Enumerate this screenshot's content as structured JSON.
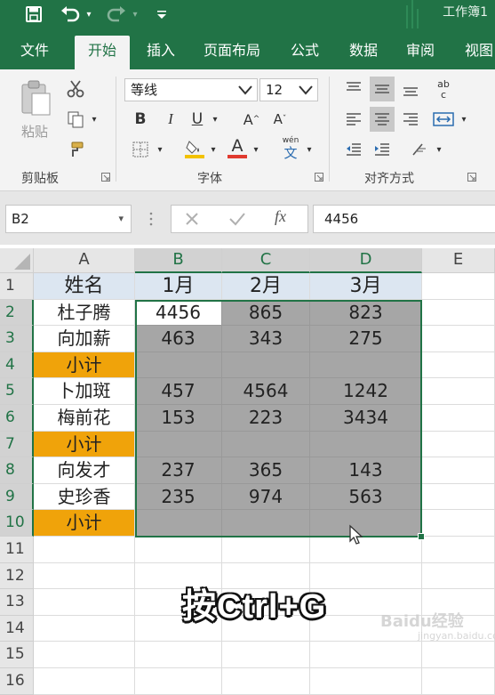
{
  "title_bar": {
    "window_title": "工作簿1",
    "icons": [
      "save-icon",
      "undo-icon",
      "redo-icon",
      "customize-qat-icon"
    ]
  },
  "tabs": [
    "文件",
    "开始",
    "插入",
    "页面布局",
    "公式",
    "数据",
    "审阅",
    "视图"
  ],
  "active_tab": "开始",
  "ribbon": {
    "clipboard": {
      "paste_label": "粘贴",
      "group_label": "剪贴板"
    },
    "font": {
      "font_name": "等线",
      "font_size": "12",
      "bold": "B",
      "italic": "I",
      "underline": "U",
      "grow": "A",
      "shrink": "A",
      "font_color_letter": "A",
      "phonetic_top": "wén",
      "phonetic_char": "文",
      "group_label": "字体"
    },
    "alignment": {
      "wrap_top": "ab",
      "wrap_bottom": "c",
      "group_label": "对齐方式"
    },
    "colors": {
      "font_color_bar": "#e03a2f",
      "fill_color_bar": "#f2c200"
    }
  },
  "formula_bar": {
    "name_box": "B2",
    "fx": "fx",
    "formula": "4456"
  },
  "columns": [
    "A",
    "B",
    "C",
    "D",
    "E"
  ],
  "rows": [
    "1",
    "2",
    "3",
    "4",
    "5",
    "6",
    "7",
    "8",
    "9",
    "10",
    "11",
    "12",
    "13",
    "14",
    "15",
    "16"
  ],
  "sheet": {
    "header": [
      "姓名",
      "1月",
      "2月",
      "3月"
    ],
    "body": [
      [
        "杜子腾",
        "4456",
        "865",
        "823"
      ],
      [
        "向加薪",
        "463",
        "343",
        "275"
      ],
      [
        "小计",
        "",
        "",
        ""
      ],
      [
        "卜加斑",
        "457",
        "4564",
        "1242"
      ],
      [
        "梅前花",
        "153",
        "223",
        "3434"
      ],
      [
        "小计",
        "",
        "",
        ""
      ],
      [
        "向发才",
        "237",
        "365",
        "143"
      ],
      [
        "史珍香",
        "235",
        "974",
        "563"
      ],
      [
        "小计",
        "",
        "",
        ""
      ]
    ]
  },
  "caption": "按Ctrl+G",
  "watermark": {
    "brand": "Baidu经验",
    "url": "jingyan.baidu.com"
  }
}
